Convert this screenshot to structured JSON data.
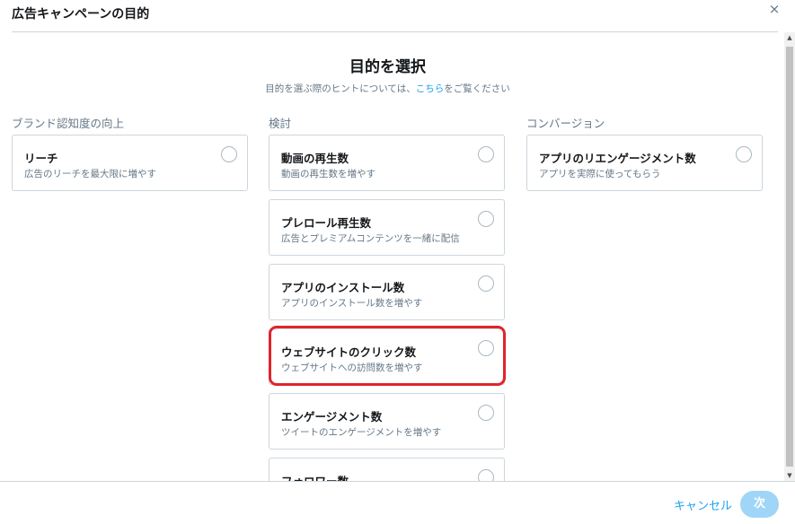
{
  "dialog": {
    "title": "広告キャンペーンの目的",
    "close_glyph": "×"
  },
  "main": {
    "title": "目的を選択",
    "hint_before": "目的を選ぶ際のヒントについては、",
    "hint_link": "こちら",
    "hint_after": "をご覧ください"
  },
  "columns": [
    {
      "header": "ブランド認知度の向上",
      "cards": [
        {
          "title": "リーチ",
          "subtitle": "広告のリーチを最大限に増やす"
        }
      ]
    },
    {
      "header": "検討",
      "cards": [
        {
          "title": "動画の再生数",
          "subtitle": "動画の再生数を増やす"
        },
        {
          "title": "プレロール再生数",
          "subtitle": "広告とプレミアムコンテンツを一緒に配信"
        },
        {
          "title": "アプリのインストール数",
          "subtitle": "アプリのインストール数を増やす"
        },
        {
          "title": "ウェブサイトのクリック数",
          "subtitle": "ウェブサイトへの訪問数を増やす"
        },
        {
          "title": "エンゲージメント数",
          "subtitle": "ツイートのエンゲージメントを増やす"
        },
        {
          "title": "フォロワー数",
          "subtitle": ""
        }
      ]
    },
    {
      "header": "コンバージョン",
      "cards": [
        {
          "title": "アプリのリエンゲージメント数",
          "subtitle": "アプリを実際に使ってもらう"
        }
      ]
    }
  ],
  "footer": {
    "cancel_label": "キャンセル",
    "next_label": "次"
  },
  "colors": {
    "accent": "#1da1f2",
    "highlight": "#e0252b",
    "next_disabled": "#9fd6f7"
  }
}
